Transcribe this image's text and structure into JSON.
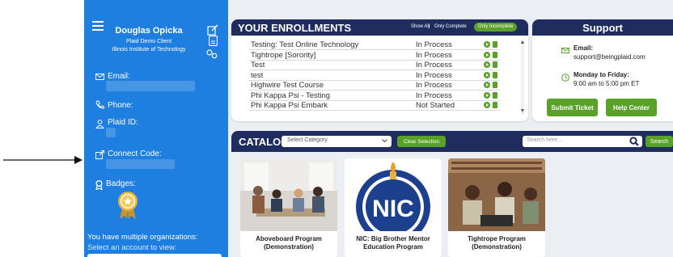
{
  "sidebar": {
    "user_name": "Douglas Opicka",
    "role": "Plaid Demo Client",
    "institution": "Illinois Institute of Technology",
    "email_label": "Email:",
    "phone_label": "Phone:",
    "plaid_id_label": "Plaid ID:",
    "connect_code_label": "Connect Code:",
    "badges_label": "Badges:",
    "multi_org_text": "You have multiple organizations:",
    "select_account_text": "Select an account to view:"
  },
  "enrollments": {
    "title": "YOUR ENROLLMENTS",
    "show_all": "Show All",
    "separator": "|",
    "only_complete": "Only Complete",
    "only_incomplete": "Only Incomplete",
    "rows": [
      {
        "title": "Testing: Test Online Technology",
        "status": "In Process"
      },
      {
        "title": "Tightrope [Sorority]",
        "status": "In Process"
      },
      {
        "title": "Test",
        "status": "In Process"
      },
      {
        "title": "test",
        "status": "In Process"
      },
      {
        "title": "Highwire Test Course",
        "status": "In Process"
      },
      {
        "title": "Phi Kappa Psi - Testing",
        "status": "In Process"
      },
      {
        "title": "Phi Kappa Psi Embark",
        "status": "Not Started"
      }
    ]
  },
  "support": {
    "title": "Support",
    "email_label": "Email:",
    "email_value": "support@beingplaid.com",
    "hours_label": "Monday to Friday:",
    "hours_value": "9:00 am to 5:00 pm ET",
    "submit_ticket": "Submit Ticket",
    "help_center": "Help Center"
  },
  "catalog": {
    "title": "CATALOG",
    "category_placeholder": "Select Category",
    "clear_selection": "Clear Selection",
    "search_placeholder": "Search here...",
    "search_button": "Search",
    "items": [
      {
        "line1": "Aboveboard Program",
        "line2": "(Demonstration)"
      },
      {
        "line1": "NIC: Big Brother Mentor",
        "line2": "Education Program",
        "logo_text": "NIC"
      },
      {
        "line1": "Tightrope Program",
        "line2": "(Demonstration)"
      }
    ]
  },
  "colors": {
    "sidebar_blue": "#1f7fe0",
    "header_navy": "#1f2d5e",
    "accent_green": "#5aa12a",
    "badge_gold": "#e8b33a"
  }
}
